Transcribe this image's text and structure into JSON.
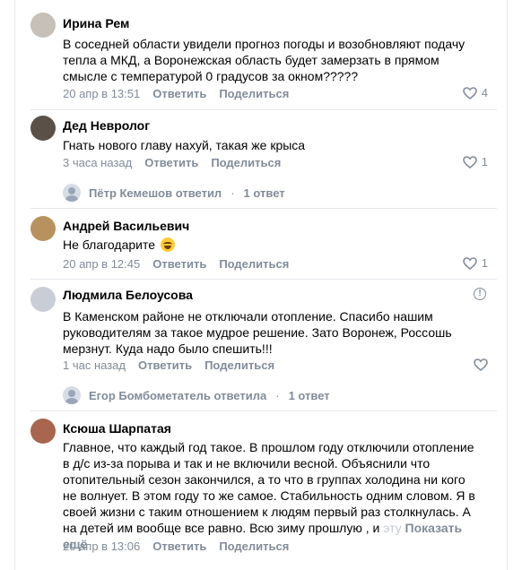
{
  "comments": [
    {
      "author": "Ирина Рем",
      "text_lines": [
        "В соседней области увидели прогноз погоды и возобновляют подачу",
        "тепла а МКД, а Воронежская область будет замерзать в прямом",
        "смысле с температурой 0 градусов за окном?????"
      ],
      "time": "20 апр в 13:51",
      "reply": "Ответить",
      "share": "Поделиться",
      "likes": "4",
      "avatar_color": "#c6c0b8"
    },
    {
      "author": "Дед Невролог",
      "text_lines": [
        "Гнать нового главу нахуй, такая же крыса"
      ],
      "time": "3 часа назад",
      "reply": "Ответить",
      "share": "Поделиться",
      "likes": "1",
      "avatar_color": "#5a5048",
      "thread": {
        "who": "Пётр Кемешов ответил",
        "sep": "·",
        "count": "1 ответ"
      }
    },
    {
      "author": "Андрей Васильевич",
      "text_lines": [
        "Не благодарите"
      ],
      "time": "20 апр в 12:45",
      "reply": "Ответить",
      "share": "Поделиться",
      "likes": "1",
      "avatar_color": "#b8925e"
    },
    {
      "author": "Людмила Белоусова",
      "text_lines": [
        "В Каменском районе не отключали отопление. Спасибо нашим",
        "руководителям за такое мудрое решение. Зато Воронеж, Россошь",
        "мерзнут. Куда надо было спешить!!!"
      ],
      "time": "1 час назад",
      "reply": "Ответить",
      "share": "Поделиться",
      "likes": "",
      "avatar_color": "#c9ced6",
      "thread": {
        "who": "Егор Бомбометатель ответила",
        "sep": "·",
        "count": "1 ответ"
      }
    },
    {
      "author": "Ксюша Шарпатая",
      "text_lines": [
        "Главное, что каждый год такое. В прошлом году отключили отопление",
        "в д/с из-за порыва и так и не включили весной. Объяснили что",
        "отопительный сезон закончился, а то что в группах холодина ни кого",
        "не волнует. В этом году то же самое. Стабильность одним словом. Я в",
        "своей жизни с таким отношением к людям первый раз столкнулась. А",
        "на детей им вообще все равно. Всю зиму прошлую , и"
      ],
      "text_fade": "эту",
      "show_more": "Показать ещё",
      "time": "20 апр в 13:06",
      "reply": "Ответить",
      "share": "Поделиться",
      "avatar_color": "#a8664f"
    }
  ],
  "colors": {
    "muted": "#818c99",
    "separator": "#e7e8ec"
  },
  "icons": {
    "like": "heart-icon",
    "report": "warning-icon"
  }
}
